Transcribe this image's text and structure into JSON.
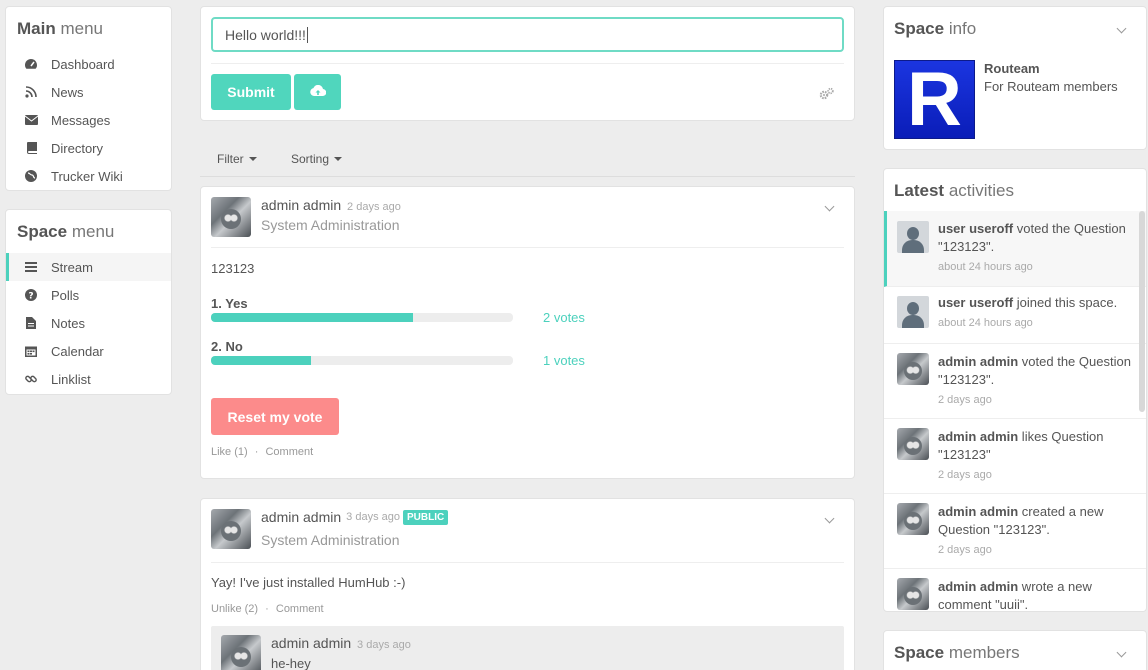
{
  "main_menu": {
    "title_bold": "Main",
    "title_light": "menu",
    "items": [
      {
        "label": "Dashboard",
        "icon": "dashboard-icon"
      },
      {
        "label": "News",
        "icon": "rss-icon"
      },
      {
        "label": "Messages",
        "icon": "envelope-icon"
      },
      {
        "label": "Directory",
        "icon": "book-icon"
      },
      {
        "label": "Trucker Wiki",
        "icon": "globe-icon"
      }
    ]
  },
  "space_menu": {
    "title_bold": "Space",
    "title_light": "menu",
    "items": [
      {
        "label": "Stream",
        "icon": "list-icon",
        "active": true
      },
      {
        "label": "Polls",
        "icon": "question-icon"
      },
      {
        "label": "Notes",
        "icon": "file-icon"
      },
      {
        "label": "Calendar",
        "icon": "calendar-icon"
      },
      {
        "label": "Linklist",
        "icon": "link-icon"
      }
    ]
  },
  "composer": {
    "value": "Hello world!!!",
    "submit_label": "Submit",
    "upload_icon": "cloud-upload-icon",
    "settings_icon": "gears-icon"
  },
  "stream_controls": {
    "filter_label": "Filter",
    "sorting_label": "Sorting"
  },
  "post1": {
    "author": "admin admin",
    "time": "2 days ago",
    "space": "System Administration",
    "question": "123123",
    "answers": [
      {
        "label": "1. Yes",
        "votes": "2 votes",
        "fraction": 0.67
      },
      {
        "label": "2. No",
        "votes": "1 votes",
        "fraction": 0.33
      }
    ],
    "reset_label": "Reset my vote",
    "like_label": "Like (1)",
    "comment_label": "Comment"
  },
  "post2": {
    "author": "admin admin",
    "time": "3 days ago",
    "badge": "PUBLIC",
    "space": "System Administration",
    "text": "Yay! I've just installed HumHub :-)",
    "unlike_label": "Unlike (2)",
    "comment_label": "Comment",
    "comment": {
      "author": "admin admin",
      "time": "3 days ago",
      "text": "he-hey"
    }
  },
  "space_info": {
    "title_bold": "Space",
    "title_light": "info",
    "logo_letter": "R",
    "name": "Routeam",
    "description": "For Routeam members"
  },
  "latest_activities": {
    "title_bold": "Latest",
    "title_light": "activities",
    "items": [
      {
        "user": "user useroff",
        "action": " voted the Question \"123123\".",
        "time": "about 24 hours ago"
      },
      {
        "user": "user useroff",
        "action": " joined this space.",
        "time": "about 24 hours ago"
      },
      {
        "user": "admin admin",
        "action": " voted the Question \"123123\".",
        "time": "2 days ago"
      },
      {
        "user": "admin admin",
        "action": " likes Question \"123123\"",
        "time": "2 days ago"
      },
      {
        "user": "admin admin",
        "action": " created a new Question \"123123\".",
        "time": "2 days ago"
      },
      {
        "user": "admin admin",
        "action": " wrote a new comment \"uuii\".",
        "time": ""
      }
    ]
  },
  "space_members": {
    "title_bold": "Space",
    "title_light": "members"
  },
  "colors": {
    "accent": "#4cd1bd",
    "danger": "#fc8b8b"
  }
}
